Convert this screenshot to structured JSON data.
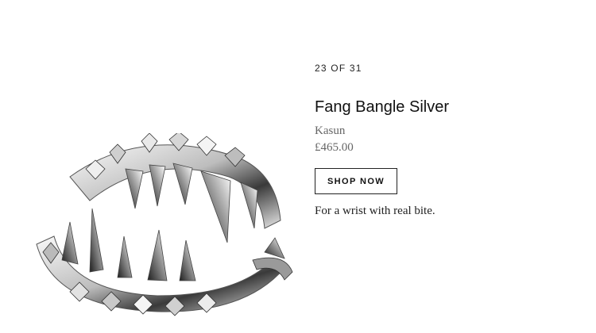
{
  "product": {
    "counter": "23 OF 31",
    "title": "Fang Bangle Silver",
    "brand": "Kasun",
    "price": "£465.00",
    "cta_label": "SHOP NOW",
    "tagline": "For a wrist with real bite.",
    "image_icon": "spiked-silver-bangle-image"
  },
  "colors": {
    "background": "#ffffff",
    "text": "#111111",
    "muted": "#666666",
    "metal_light": "#f2f2f2",
    "metal_mid": "#b8b8b8",
    "metal_dark": "#2a2a2a"
  }
}
